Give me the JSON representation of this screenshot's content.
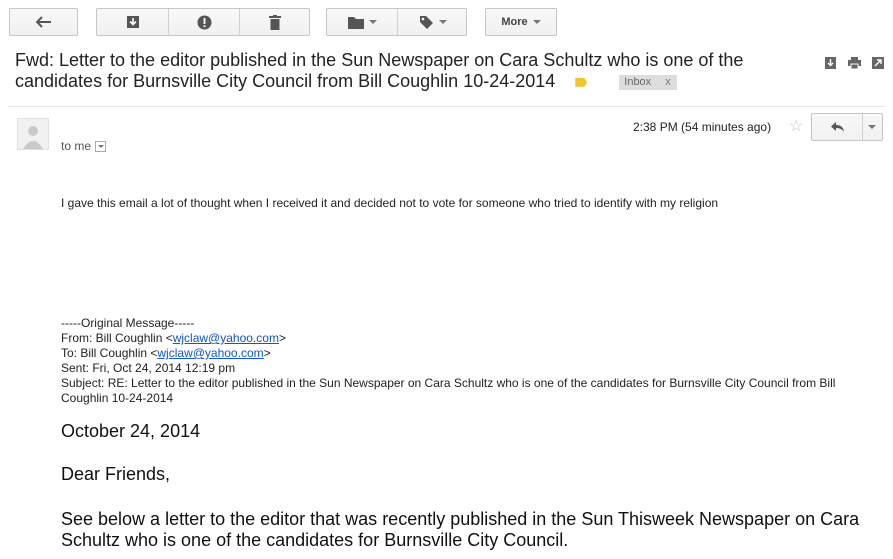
{
  "toolbar": {
    "more_label": "More",
    "icons": [
      "back-arrow-icon",
      "archive-icon",
      "report-spam-icon",
      "delete-icon",
      "folder-icon",
      "label-icon"
    ]
  },
  "subject": {
    "text": "Fwd: Letter to the editor published in the Sun Newspaper on Cara Schultz who is one of the candidates for Burnsville City Council from Bill Coughlin 10-24-2014",
    "inbox_label": "Inbox",
    "inbox_remove": "x"
  },
  "message": {
    "to": "to me",
    "time": "2:38 PM (54 minutes ago)",
    "body": "I gave this email a lot of thought when I received it and decided not to vote for someone who tried to identify with my religion"
  },
  "original": {
    "header": "-----Original Message-----",
    "from_label": "From: Bill Coughlin <",
    "from_email": "wjclaw@yahoo.com",
    "to_label": "To: Bill Coughlin <",
    "to_email": "wjclaw@yahoo.com",
    "close": ">",
    "sent": "Sent: Fri, Oct 24, 2014 12:19 pm",
    "subject": "Subject: RE: Letter to the editor published in the Sun Newspaper on Cara Schultz who is one of the candidates for Burnsville City Council from Bill Coughlin 10-24-2014"
  },
  "letter": {
    "date": "October 24, 2014",
    "greeting": "Dear Friends,",
    "para1": "See below a letter to the editor that was recently published in the Sun Thisweek Newspaper on Cara Schultz who is one of the candidates for Burnsville City Council."
  },
  "colors": {
    "link": "#1155cc",
    "label_tag": "#f4c431"
  }
}
